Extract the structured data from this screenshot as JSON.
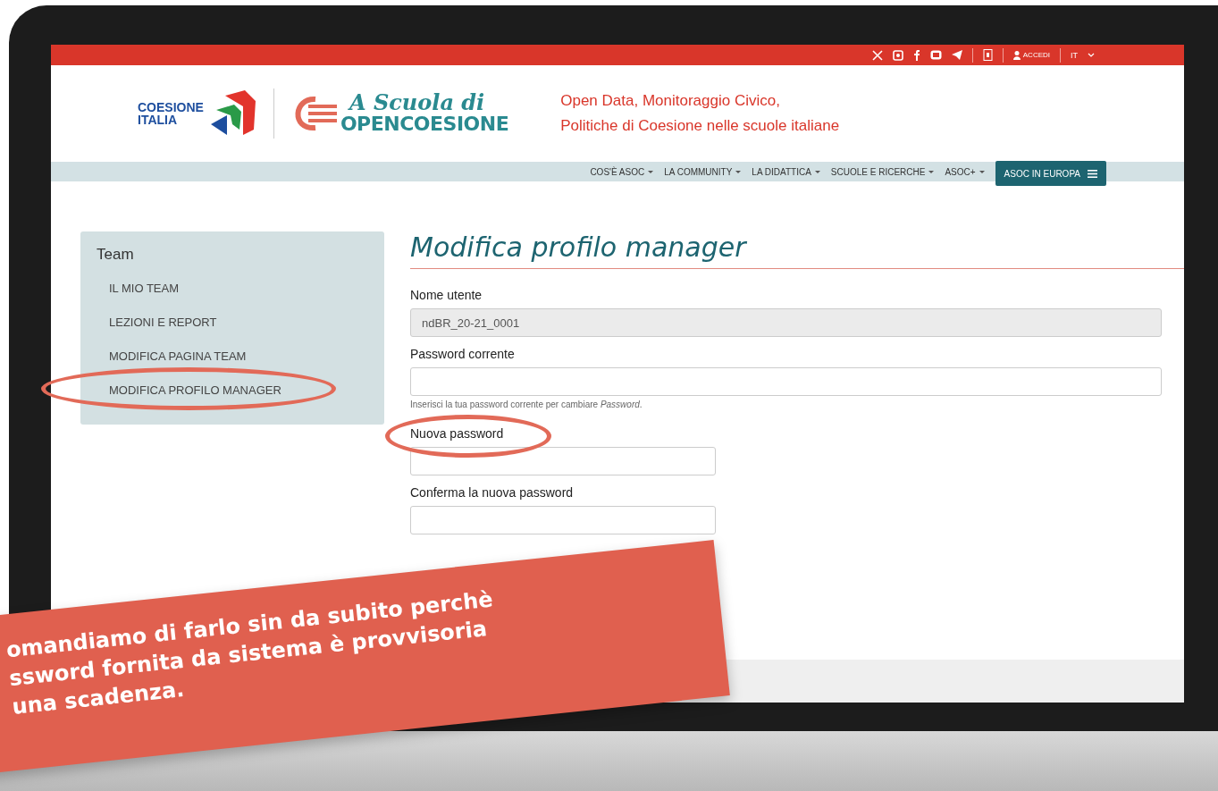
{
  "top_bar": {
    "login": "ACCEDI",
    "language": "IT"
  },
  "header": {
    "coesione_logo": [
      "COESIONE",
      "ITALIA"
    ],
    "asoc_logo": [
      "A Scuola di",
      "OPENCOESIONE"
    ],
    "tagline": [
      "Open Data, Monitoraggio Civico,",
      "Politiche di Coesione nelle scuole italiane"
    ]
  },
  "nav": {
    "items": [
      {
        "label": "COS'È ASOC",
        "dropdown": true,
        "selected": false
      },
      {
        "label": "LA COMMUNITY",
        "dropdown": true,
        "selected": false
      },
      {
        "label": "LA DIDATTICA",
        "dropdown": true,
        "selected": false
      },
      {
        "label": "SCUOLE E RICERCHE",
        "dropdown": true,
        "selected": false
      },
      {
        "label": "ASOC+",
        "dropdown": true,
        "selected": false
      },
      {
        "label": "ASOC IN EUROPA",
        "dropdown": false,
        "selected": true
      }
    ]
  },
  "sidebar": {
    "title": "Team",
    "items": [
      {
        "label": "IL MIO TEAM",
        "circled": false
      },
      {
        "label": "LEZIONI E REPORT",
        "circled": false
      },
      {
        "label": "MODIFICA PAGINA TEAM",
        "circled": false
      },
      {
        "label": "MODIFICA PROFILO MANAGER",
        "circled": true
      }
    ]
  },
  "form": {
    "title": "Modifica profilo manager",
    "fields": [
      {
        "label": "Nome utente",
        "value": "ndBR_20-21_0001",
        "disabled": true,
        "kind": "wide",
        "circled": false
      },
      {
        "label": "Password corrente",
        "disabled": false,
        "kind": "wide",
        "circled": false,
        "hint": "Inserisci la tua password corrente per cambiare *Password*."
      },
      {
        "label": "Nuova password",
        "disabled": false,
        "kind": "short",
        "circled": true
      },
      {
        "label": "Conferma la nuova password",
        "disabled": false,
        "kind": "short",
        "circled": false
      }
    ]
  },
  "banner": {
    "lines": [
      "omandiamo di farlo sin da subito perchè",
      "ssword fornita da sistema è provvisoria",
      "una scadenza."
    ]
  }
}
